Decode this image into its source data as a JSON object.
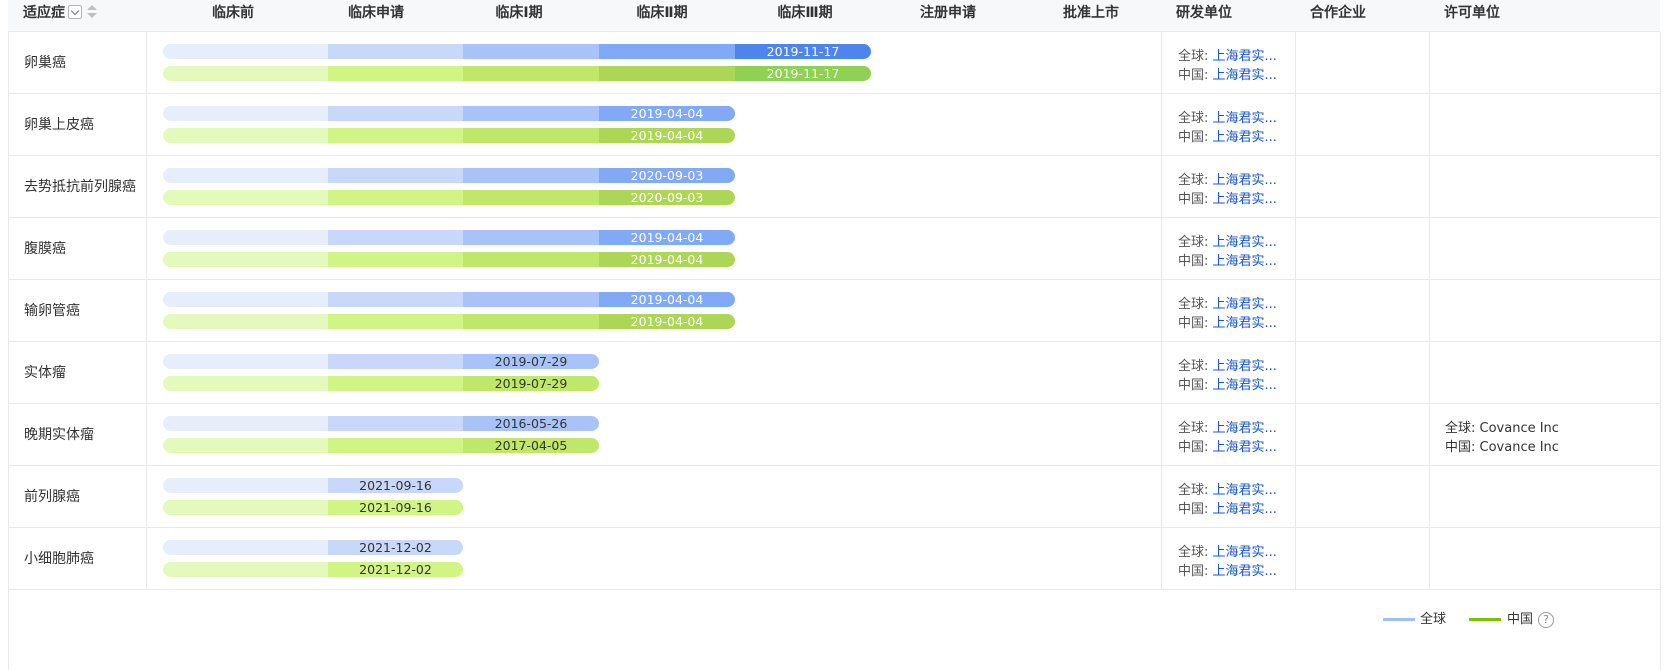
{
  "header": {
    "indication": "适应症",
    "phases": [
      "临床前",
      "临床申请",
      "临床Ⅰ期",
      "临床Ⅱ期",
      "临床Ⅲ期",
      "注册申请",
      "批准上市"
    ],
    "dev_unit": "研发单位",
    "partner": "合作企业",
    "license": "许可单位"
  },
  "colors": {
    "global_phase_1": "#e6eefc",
    "global_phase_2": "#c7d8fa",
    "global_phase_3": "#a8c3f8",
    "global_phase_4": "#82a9f5",
    "global_phase_5": "#4d84ee",
    "china_phase_1": "#e4f9bc",
    "china_phase_2": "#d1f585",
    "china_phase_3": "#bfe86a",
    "china_phase_4": "#acd656",
    "china_phase_5": "#8fd152",
    "legend_global": "#a3bdf5",
    "legend_china": "#7bc100",
    "link": "#1a56c8"
  },
  "rows": [
    {
      "indication": "卵巢癌",
      "global_date": "2019-11-17",
      "global_phase": 5,
      "china_date": "2019-11-17",
      "china_phase": 5,
      "dev_global_key": "全球:",
      "dev_global": "上海君实...",
      "dev_china_key": "中国:",
      "dev_china": "上海君实...",
      "partner": "",
      "lic_global": "",
      "lic_china": ""
    },
    {
      "indication": "卵巢上皮癌",
      "global_date": "2019-04-04",
      "global_phase": 4,
      "china_date": "2019-04-04",
      "china_phase": 4,
      "dev_global_key": "全球:",
      "dev_global": "上海君实...",
      "dev_china_key": "中国:",
      "dev_china": "上海君实...",
      "partner": "",
      "lic_global": "",
      "lic_china": ""
    },
    {
      "indication": "去势抵抗前列腺癌",
      "global_date": "2020-09-03",
      "global_phase": 4,
      "china_date": "2020-09-03",
      "china_phase": 4,
      "dev_global_key": "全球:",
      "dev_global": "上海君实...",
      "dev_china_key": "中国:",
      "dev_china": "上海君实...",
      "partner": "",
      "lic_global": "",
      "lic_china": ""
    },
    {
      "indication": "腹膜癌",
      "global_date": "2019-04-04",
      "global_phase": 4,
      "china_date": "2019-04-04",
      "china_phase": 4,
      "dev_global_key": "全球:",
      "dev_global": "上海君实...",
      "dev_china_key": "中国:",
      "dev_china": "上海君实...",
      "partner": "",
      "lic_global": "",
      "lic_china": ""
    },
    {
      "indication": "输卵管癌",
      "global_date": "2019-04-04",
      "global_phase": 4,
      "china_date": "2019-04-04",
      "china_phase": 4,
      "dev_global_key": "全球:",
      "dev_global": "上海君实...",
      "dev_china_key": "中国:",
      "dev_china": "上海君实...",
      "partner": "",
      "lic_global": "",
      "lic_china": ""
    },
    {
      "indication": "实体瘤",
      "global_date": "2019-07-29",
      "global_phase": 3,
      "china_date": "2019-07-29",
      "china_phase": 3,
      "dev_global_key": "全球:",
      "dev_global": "上海君实...",
      "dev_china_key": "中国:",
      "dev_china": "上海君实...",
      "partner": "",
      "lic_global": "",
      "lic_china": ""
    },
    {
      "indication": "晚期实体瘤",
      "global_date": "2016-05-26",
      "global_phase": 3,
      "china_date": "2017-04-05",
      "china_phase": 3,
      "dev_global_key": "全球:",
      "dev_global": "上海君实...",
      "dev_china_key": "中国:",
      "dev_china": "上海君实...",
      "partner": "",
      "lic_global": "全球:  Covance Inc",
      "lic_china": "中国:  Covance Inc"
    },
    {
      "indication": "前列腺癌",
      "global_date": "2021-09-16",
      "global_phase": 2,
      "china_date": "2021-09-16",
      "china_phase": 2,
      "dev_global_key": "全球:",
      "dev_global": "上海君实...",
      "dev_china_key": "中国:",
      "dev_china": "上海君实...",
      "partner": "",
      "lic_global": "",
      "lic_china": ""
    },
    {
      "indication": "小细胞肺癌",
      "global_date": "2021-12-02",
      "global_phase": 2,
      "china_date": "2021-12-02",
      "china_phase": 2,
      "dev_global_key": "全球:",
      "dev_global": "上海君实...",
      "dev_china_key": "中国:",
      "dev_china": "上海君实...",
      "partner": "",
      "lic_global": "",
      "lic_china": ""
    }
  ],
  "legend": {
    "global": "全球",
    "china": "中国",
    "help": "?"
  }
}
